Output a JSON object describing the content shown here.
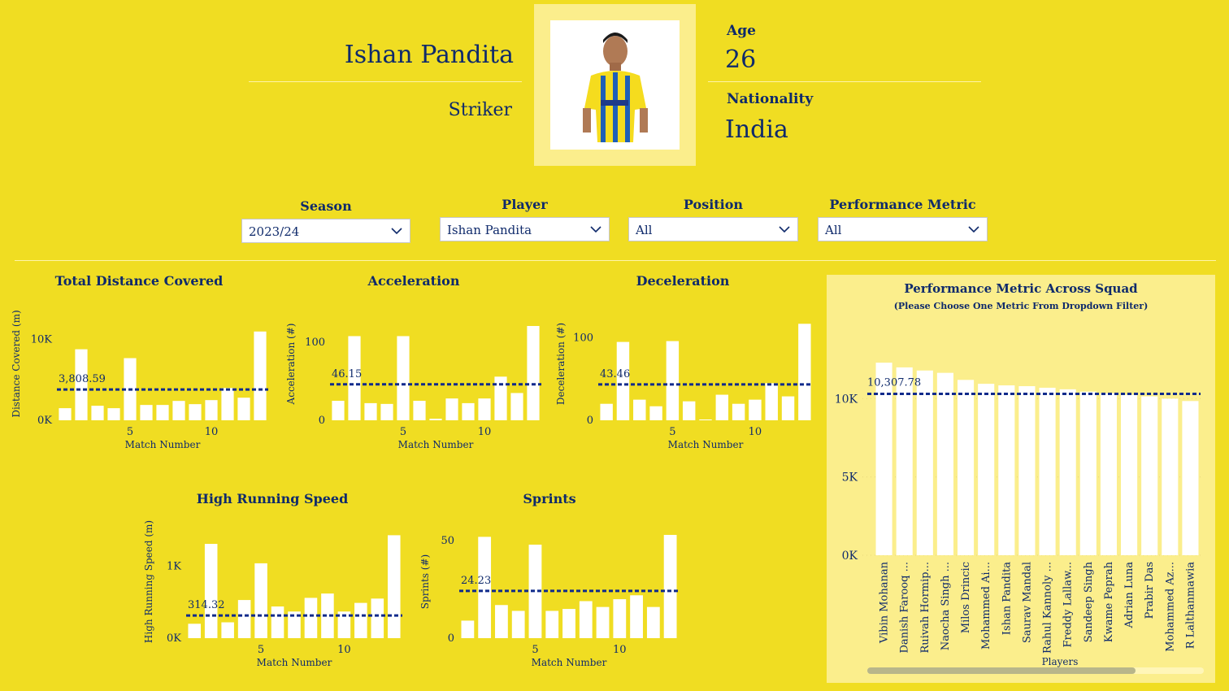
{
  "player": {
    "name": "Ishan Pandita",
    "position": "Striker",
    "age_label": "Age",
    "age": "26",
    "nationality_label": "Nationality",
    "nationality": "India"
  },
  "filters": {
    "season": {
      "label": "Season",
      "value": "2023/24"
    },
    "player": {
      "label": "Player",
      "value": "Ishan Pandita"
    },
    "position": {
      "label": "Position",
      "value": "All"
    },
    "metric": {
      "label": "Performance Metric",
      "value": "All"
    }
  },
  "colors": {
    "background": "#f0dd22",
    "bar": "#ffffff",
    "text": "#0f2a6b",
    "avg_line": "#0f2a8b",
    "panel": "#fbee8c"
  },
  "chart_data": [
    {
      "type": "bar",
      "title": "Total Distance Covered",
      "xlabel": "Match Number",
      "ylabel": "Distance Covered (m)",
      "categories": [
        1,
        2,
        3,
        4,
        5,
        6,
        7,
        8,
        9,
        10,
        11,
        12,
        13
      ],
      "values": [
        1500,
        8800,
        1800,
        1500,
        7700,
        1900,
        1900,
        2400,
        2000,
        2500,
        4000,
        2800,
        11000
      ],
      "ylim": [
        0,
        14000
      ],
      "yticks": [
        0,
        10000
      ],
      "ytick_labels": [
        "0K",
        "10K"
      ],
      "xticks": [
        5,
        10
      ],
      "average": 3808.59,
      "average_label": "3,808.59"
    },
    {
      "type": "bar",
      "title": "Acceleration",
      "xlabel": "Match Number",
      "ylabel": "Acceleration (#)",
      "categories": [
        1,
        2,
        3,
        4,
        5,
        6,
        7,
        8,
        9,
        10,
        11,
        12,
        13
      ],
      "values": [
        25,
        108,
        22,
        21,
        108,
        25,
        2,
        28,
        22,
        28,
        56,
        35,
        121
      ],
      "ylim": [
        0,
        145
      ],
      "yticks": [
        0,
        100
      ],
      "ytick_labels": [
        "0",
        "100"
      ],
      "xticks": [
        5,
        10
      ],
      "average": 46.15,
      "average_label": "46.15"
    },
    {
      "type": "bar",
      "title": "Deceleration",
      "xlabel": "Match Number",
      "ylabel": "Deceleration (#)",
      "categories": [
        1,
        2,
        3,
        4,
        5,
        6,
        7,
        8,
        9,
        10,
        11,
        12,
        13
      ],
      "values": [
        20,
        95,
        25,
        17,
        96,
        23,
        1,
        31,
        20,
        25,
        45,
        29,
        117
      ],
      "ylim": [
        0,
        137
      ],
      "yticks": [
        0,
        100
      ],
      "ytick_labels": [
        "0",
        "100"
      ],
      "xticks": [
        5,
        10
      ],
      "average": 43.46,
      "average_label": "43.46"
    },
    {
      "type": "bar",
      "title": "High Running Speed",
      "xlabel": "Match Number",
      "ylabel": "High Running Speed (m)",
      "categories": [
        1,
        2,
        3,
        4,
        5,
        6,
        7,
        8,
        9,
        10,
        11,
        12,
        13
      ],
      "values": [
        200,
        1310,
        220,
        530,
        1040,
        440,
        370,
        560,
        620,
        370,
        490,
        550,
        1430
      ],
      "ylim": [
        0,
        1570
      ],
      "yticks": [
        0,
        1000
      ],
      "ytick_labels": [
        "0K",
        "1K"
      ],
      "xticks": [
        5,
        10
      ],
      "average": 314.32,
      "average_label": "314.32"
    },
    {
      "type": "bar",
      "title": "Sprints",
      "xlabel": "Match Number",
      "ylabel": "Sprints (#)",
      "categories": [
        1,
        2,
        3,
        4,
        5,
        6,
        7,
        8,
        9,
        10,
        11,
        12,
        13
      ],
      "values": [
        9,
        52,
        17,
        14,
        48,
        14,
        15,
        19,
        16,
        20,
        22,
        16,
        53
      ],
      "ylim": [
        0,
        58
      ],
      "yticks": [
        0,
        50
      ],
      "ytick_labels": [
        "0",
        "50"
      ],
      "xticks": [
        5,
        10
      ],
      "average": 24.23,
      "average_label": "24.23"
    },
    {
      "type": "bar",
      "title": "Performance Metric Across Squad",
      "subtitle": "(Please Choose One Metric From Dropdown Filter)",
      "xlabel": "Players",
      "ylabel": "",
      "categories": [
        "Vibin Mohanan",
        "Danish Farooq ...",
        "Ruivah Hormip...",
        "Naocha Singh ...",
        "Milos Drincic",
        "Mohammed Ai...",
        "Ishan Pandita",
        "Saurav Mandal",
        "Rahul Kannoly ...",
        "Freddy Lallaw...",
        "Sandeep Singh",
        "Kwame Peprah",
        "Adrian Luna",
        "Prabir Das",
        "Mohammed Az...",
        "R Lalthanmawia"
      ],
      "values": [
        12300,
        12000,
        11800,
        11650,
        11200,
        10950,
        10850,
        10800,
        10700,
        10600,
        10450,
        10350,
        10250,
        10150,
        10000,
        9850
      ],
      "ylim": [
        0,
        14800
      ],
      "yticks": [
        0,
        5000,
        10000
      ],
      "ytick_labels": [
        "0K",
        "5K",
        "10K"
      ],
      "average": 10307.78,
      "average_label": "10,307.78"
    }
  ]
}
